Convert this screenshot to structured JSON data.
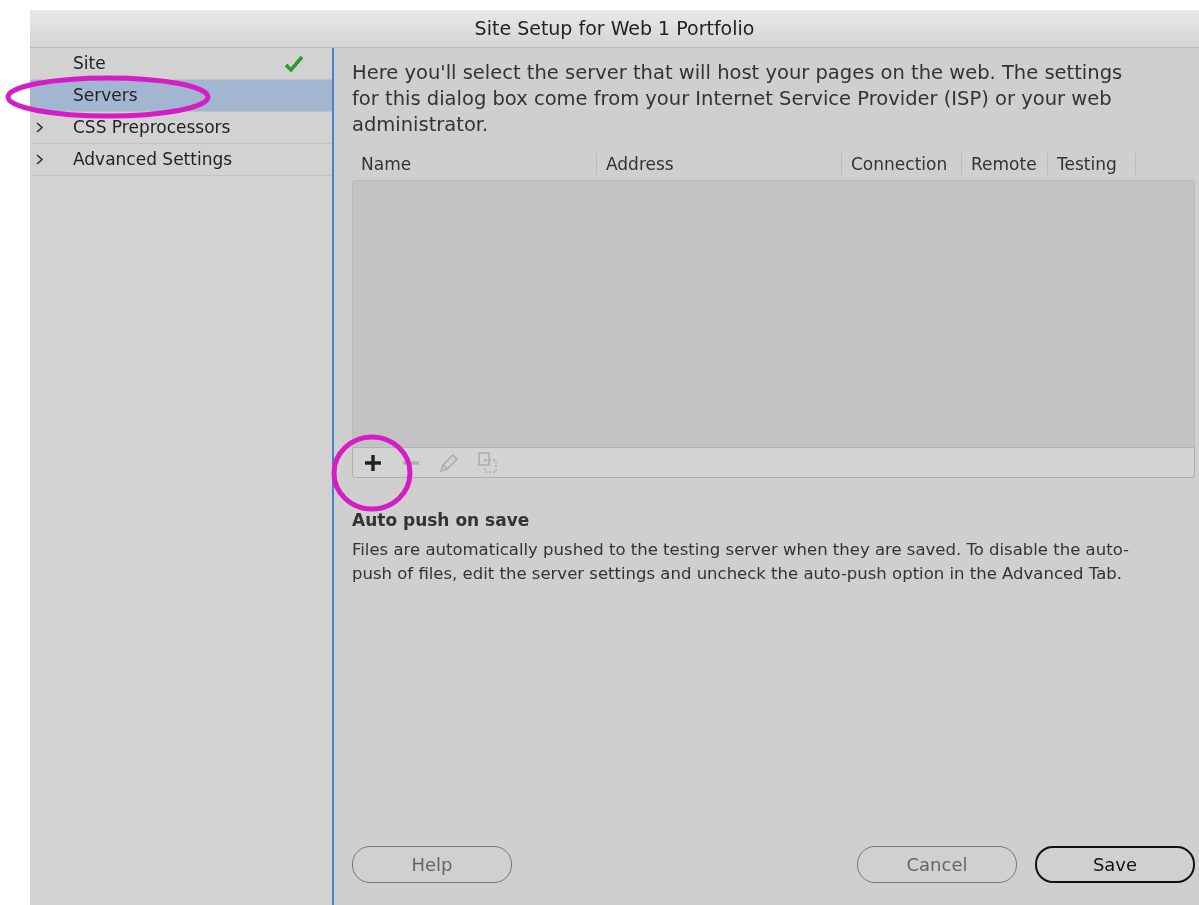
{
  "window": {
    "title": "Site Setup for Web 1 Portfolio"
  },
  "sidebar": {
    "items": [
      {
        "label": "Site",
        "kind": "page",
        "selected": false,
        "complete": true
      },
      {
        "label": "Servers",
        "kind": "page",
        "selected": true,
        "complete": false
      },
      {
        "label": "CSS Preprocessors",
        "kind": "group",
        "selected": false,
        "complete": false
      },
      {
        "label": "Advanced Settings",
        "kind": "group",
        "selected": false,
        "complete": false
      }
    ]
  },
  "intro": "Here you'll select the server that will host your pages on the web. The settings for this dialog box come from your Internet Service Provider (ISP) or your web administrator.",
  "table": {
    "columns": [
      "Name",
      "Address",
      "Connection",
      "Remote",
      "Testing"
    ]
  },
  "toolbar": [
    {
      "kind": "add",
      "disabled": false
    },
    {
      "kind": "remove",
      "disabled": true
    },
    {
      "kind": "edit",
      "disabled": true
    },
    {
      "kind": "duplicate",
      "disabled": true
    }
  ],
  "auto_push": {
    "heading": "Auto push on save",
    "text": "Files are automatically pushed to the testing server when they are saved. To disable the auto-push of files, edit the server settings and uncheck the auto-push option in the Advanced Tab."
  },
  "buttons": [
    {
      "label": "Help",
      "default": false
    },
    {
      "label": "Cancel",
      "default": false
    },
    {
      "label": "Save",
      "default": true
    }
  ]
}
